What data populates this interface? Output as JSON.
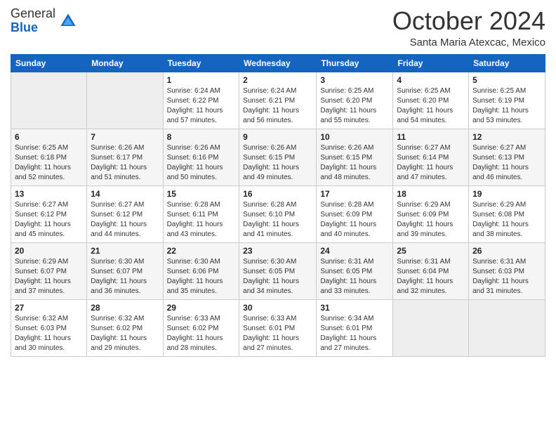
{
  "header": {
    "logo_general": "General",
    "logo_blue": "Blue",
    "month_title": "October 2024",
    "subtitle": "Santa Maria Atexcac, Mexico"
  },
  "days_of_week": [
    "Sunday",
    "Monday",
    "Tuesday",
    "Wednesday",
    "Thursday",
    "Friday",
    "Saturday"
  ],
  "weeks": [
    [
      {
        "day": "",
        "info": ""
      },
      {
        "day": "",
        "info": ""
      },
      {
        "day": "1",
        "sunrise": "Sunrise: 6:24 AM",
        "sunset": "Sunset: 6:22 PM",
        "daylight": "Daylight: 11 hours and 57 minutes."
      },
      {
        "day": "2",
        "sunrise": "Sunrise: 6:24 AM",
        "sunset": "Sunset: 6:21 PM",
        "daylight": "Daylight: 11 hours and 56 minutes."
      },
      {
        "day": "3",
        "sunrise": "Sunrise: 6:25 AM",
        "sunset": "Sunset: 6:20 PM",
        "daylight": "Daylight: 11 hours and 55 minutes."
      },
      {
        "day": "4",
        "sunrise": "Sunrise: 6:25 AM",
        "sunset": "Sunset: 6:20 PM",
        "daylight": "Daylight: 11 hours and 54 minutes."
      },
      {
        "day": "5",
        "sunrise": "Sunrise: 6:25 AM",
        "sunset": "Sunset: 6:19 PM",
        "daylight": "Daylight: 11 hours and 53 minutes."
      }
    ],
    [
      {
        "day": "6",
        "sunrise": "Sunrise: 6:25 AM",
        "sunset": "Sunset: 6:18 PM",
        "daylight": "Daylight: 11 hours and 52 minutes."
      },
      {
        "day": "7",
        "sunrise": "Sunrise: 6:26 AM",
        "sunset": "Sunset: 6:17 PM",
        "daylight": "Daylight: 11 hours and 51 minutes."
      },
      {
        "day": "8",
        "sunrise": "Sunrise: 6:26 AM",
        "sunset": "Sunset: 6:16 PM",
        "daylight": "Daylight: 11 hours and 50 minutes."
      },
      {
        "day": "9",
        "sunrise": "Sunrise: 6:26 AM",
        "sunset": "Sunset: 6:15 PM",
        "daylight": "Daylight: 11 hours and 49 minutes."
      },
      {
        "day": "10",
        "sunrise": "Sunrise: 6:26 AM",
        "sunset": "Sunset: 6:15 PM",
        "daylight": "Daylight: 11 hours and 48 minutes."
      },
      {
        "day": "11",
        "sunrise": "Sunrise: 6:27 AM",
        "sunset": "Sunset: 6:14 PM",
        "daylight": "Daylight: 11 hours and 47 minutes."
      },
      {
        "day": "12",
        "sunrise": "Sunrise: 6:27 AM",
        "sunset": "Sunset: 6:13 PM",
        "daylight": "Daylight: 11 hours and 46 minutes."
      }
    ],
    [
      {
        "day": "13",
        "sunrise": "Sunrise: 6:27 AM",
        "sunset": "Sunset: 6:12 PM",
        "daylight": "Daylight: 11 hours and 45 minutes."
      },
      {
        "day": "14",
        "sunrise": "Sunrise: 6:27 AM",
        "sunset": "Sunset: 6:12 PM",
        "daylight": "Daylight: 11 hours and 44 minutes."
      },
      {
        "day": "15",
        "sunrise": "Sunrise: 6:28 AM",
        "sunset": "Sunset: 6:11 PM",
        "daylight": "Daylight: 11 hours and 43 minutes."
      },
      {
        "day": "16",
        "sunrise": "Sunrise: 6:28 AM",
        "sunset": "Sunset: 6:10 PM",
        "daylight": "Daylight: 11 hours and 41 minutes."
      },
      {
        "day": "17",
        "sunrise": "Sunrise: 6:28 AM",
        "sunset": "Sunset: 6:09 PM",
        "daylight": "Daylight: 11 hours and 40 minutes."
      },
      {
        "day": "18",
        "sunrise": "Sunrise: 6:29 AM",
        "sunset": "Sunset: 6:09 PM",
        "daylight": "Daylight: 11 hours and 39 minutes."
      },
      {
        "day": "19",
        "sunrise": "Sunrise: 6:29 AM",
        "sunset": "Sunset: 6:08 PM",
        "daylight": "Daylight: 11 hours and 38 minutes."
      }
    ],
    [
      {
        "day": "20",
        "sunrise": "Sunrise: 6:29 AM",
        "sunset": "Sunset: 6:07 PM",
        "daylight": "Daylight: 11 hours and 37 minutes."
      },
      {
        "day": "21",
        "sunrise": "Sunrise: 6:30 AM",
        "sunset": "Sunset: 6:07 PM",
        "daylight": "Daylight: 11 hours and 36 minutes."
      },
      {
        "day": "22",
        "sunrise": "Sunrise: 6:30 AM",
        "sunset": "Sunset: 6:06 PM",
        "daylight": "Daylight: 11 hours and 35 minutes."
      },
      {
        "day": "23",
        "sunrise": "Sunrise: 6:30 AM",
        "sunset": "Sunset: 6:05 PM",
        "daylight": "Daylight: 11 hours and 34 minutes."
      },
      {
        "day": "24",
        "sunrise": "Sunrise: 6:31 AM",
        "sunset": "Sunset: 6:05 PM",
        "daylight": "Daylight: 11 hours and 33 minutes."
      },
      {
        "day": "25",
        "sunrise": "Sunrise: 6:31 AM",
        "sunset": "Sunset: 6:04 PM",
        "daylight": "Daylight: 11 hours and 32 minutes."
      },
      {
        "day": "26",
        "sunrise": "Sunrise: 6:31 AM",
        "sunset": "Sunset: 6:03 PM",
        "daylight": "Daylight: 11 hours and 31 minutes."
      }
    ],
    [
      {
        "day": "27",
        "sunrise": "Sunrise: 6:32 AM",
        "sunset": "Sunset: 6:03 PM",
        "daylight": "Daylight: 11 hours and 30 minutes."
      },
      {
        "day": "28",
        "sunrise": "Sunrise: 6:32 AM",
        "sunset": "Sunset: 6:02 PM",
        "daylight": "Daylight: 11 hours and 29 minutes."
      },
      {
        "day": "29",
        "sunrise": "Sunrise: 6:33 AM",
        "sunset": "Sunset: 6:02 PM",
        "daylight": "Daylight: 11 hours and 28 minutes."
      },
      {
        "day": "30",
        "sunrise": "Sunrise: 6:33 AM",
        "sunset": "Sunset: 6:01 PM",
        "daylight": "Daylight: 11 hours and 27 minutes."
      },
      {
        "day": "31",
        "sunrise": "Sunrise: 6:34 AM",
        "sunset": "Sunset: 6:01 PM",
        "daylight": "Daylight: 11 hours and 27 minutes."
      },
      {
        "day": "",
        "info": ""
      },
      {
        "day": "",
        "info": ""
      }
    ]
  ]
}
